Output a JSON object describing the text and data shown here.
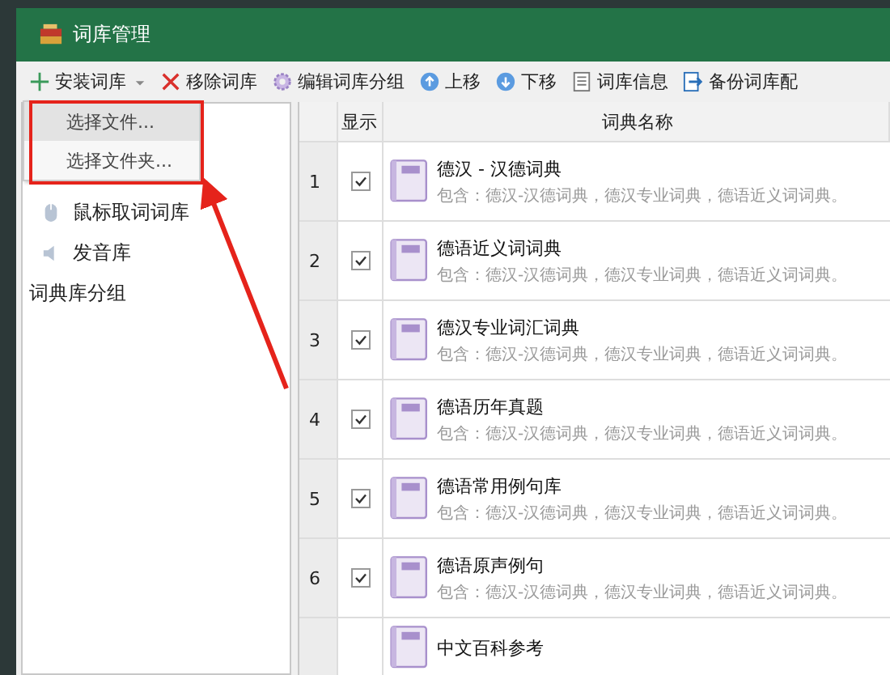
{
  "window": {
    "title": "词库管理"
  },
  "toolbar": [
    {
      "label": "安装词库",
      "kind": "plus",
      "dropdown": true
    },
    {
      "label": "移除词库",
      "kind": "cross",
      "dropdown": false
    },
    {
      "label": "编辑词库分组",
      "kind": "gear",
      "dropdown": false
    },
    {
      "label": "上移",
      "kind": "up",
      "dropdown": false
    },
    {
      "label": "下移",
      "kind": "down",
      "dropdown": false
    },
    {
      "label": "词库信息",
      "kind": "document",
      "dropdown": false
    },
    {
      "label": "备份词库配",
      "kind": "export",
      "dropdown": false
    }
  ],
  "install_menu": {
    "items": [
      {
        "label": "选择文件...",
        "selected": true
      },
      {
        "label": "选择文件夹...",
        "selected": false
      }
    ]
  },
  "sidebar": {
    "items": [
      {
        "label": "鼠标取词词库",
        "kind": "mouse"
      },
      {
        "label": "发音库",
        "kind": "speaker"
      }
    ],
    "group_heading": "词典库分组"
  },
  "table": {
    "columns": [
      "显示",
      "词典名称"
    ],
    "rows": [
      {
        "number": "1",
        "checked": true,
        "name": "德汉 - 汉德词典",
        "description": "包含：德汉-汉德词典，德汉专业词典，德语近义词词典。"
      },
      {
        "number": "2",
        "checked": true,
        "name": "德语近义词词典",
        "description": "包含：德汉-汉德词典，德汉专业词典，德语近义词词典。"
      },
      {
        "number": "3",
        "checked": true,
        "name": "德汉专业词汇词典",
        "description": "包含：德汉-汉德词典，德汉专业词典，德语近义词词典。"
      },
      {
        "number": "4",
        "checked": true,
        "name": "德语历年真题",
        "description": "包含：德汉-汉德词典，德汉专业词典，德语近义词词典。"
      },
      {
        "number": "5",
        "checked": true,
        "name": "德语常用例句库",
        "description": "包含：德汉-汉德词典，德汉专业词典，德语近义词词典。"
      },
      {
        "number": "6",
        "checked": true,
        "name": "德语原声例句",
        "description": "包含：德汉-汉德词典，德汉专业词典，德语近义词词典。"
      },
      {
        "name": "中文百科参考"
      }
    ]
  }
}
